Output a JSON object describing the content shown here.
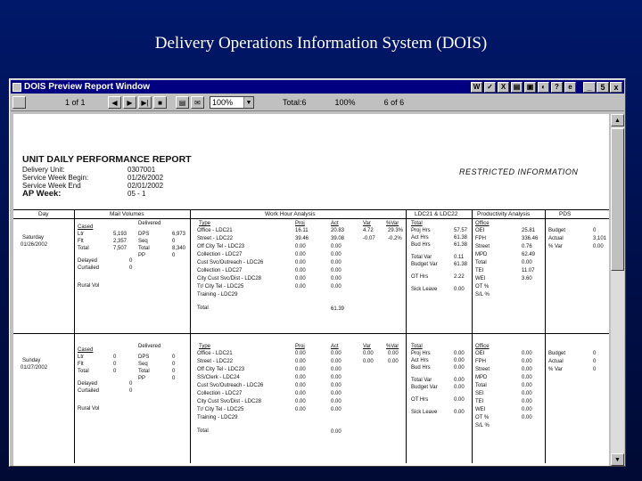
{
  "slide": {
    "title": "Delivery Operations Information System (DOIS)"
  },
  "window": {
    "title": "DOIS Preview Report Window",
    "title_icons": [
      "W",
      "✓",
      "X",
      "▤",
      "▣",
      "◐",
      "?",
      "e"
    ],
    "controls": {
      "minimize": "_",
      "restore": "5",
      "close": "x"
    }
  },
  "toolbar": {
    "page": "1 of 1",
    "zoom": "100%",
    "total": "Total:6",
    "percent": "100%",
    "of": "6 of 6",
    "buttons": [
      "◀",
      "▶",
      "▶|",
      "■"
    ]
  },
  "report": {
    "title": "UNIT DAILY PERFORMANCE REPORT",
    "restricted": "RESTRICTED INFORMATION",
    "info_labels": [
      "Delivery Unit:",
      "Service Week Begin:",
      "Service Week End",
      "AP Week:"
    ],
    "info_values": [
      "0307001",
      "01/26/2002",
      "02/01/2002",
      "05 - 1"
    ],
    "section_headers": {
      "day": "Day",
      "mail_volumes": "Mail Volumes",
      "work_hour_analysis": "Work Hour Analysis",
      "ldc": "LDC21 & LDC22",
      "productivity": "Productivity Analysis",
      "pds": "PDS"
    },
    "day1": {
      "day_name": "Saturday",
      "date": "01/26/2002",
      "cased": [
        "Cased",
        "Ltr",
        "Flt",
        "Total"
      ],
      "cased_vals": [
        "5,193",
        "2,357",
        "7,507"
      ],
      "delivered_head": "Delivered",
      "delivered": [
        "DPS",
        "Seq",
        "Total",
        "PP"
      ],
      "delivered_vals": [
        "6,973",
        "0",
        "8,340",
        "0"
      ],
      "other_vols": [
        "Delayed",
        "Curtailed",
        "Rural Vol"
      ],
      "other_vals": [
        "0",
        "0"
      ],
      "type_head": "Type",
      "types": [
        "Office - LDC21",
        "Street - LDC22",
        "Off City Tel - LDC23",
        "Collection - LDC27",
        "Cust Svc/Outreach - LDC26",
        "Collection - LDC27",
        "City Cust Svc/Dist - LDC28",
        "Tr/ City Tel - LDC25",
        "Training - LDC29",
        "Total"
      ],
      "col_heads": [
        "Proj",
        "Act",
        "Var",
        "%Var"
      ],
      "proj": [
        "16.11",
        "39.46",
        "0.00",
        "0.00",
        "0.00",
        "0.00",
        "0.00",
        "0.00"
      ],
      "act": [
        "20.83",
        "39.08",
        "0.00",
        "0.00",
        "0.00",
        "0.00",
        "0.00",
        "0.00"
      ],
      "var": [
        "4.72",
        "-0.07"
      ],
      "pvar": [
        "29.3%",
        "-0.2%"
      ],
      "total_val": "61.39",
      "mid_labels": [
        "Total",
        "Proj Hrs",
        "Act Hrs",
        "Bud Hrs",
        "Total Var",
        "Budget Var",
        "OT Hrs",
        "Sick Leave"
      ],
      "mid_vals": [
        "57.57",
        "61.38",
        "61.38",
        "0.11",
        "61.38",
        "2.22",
        "0.00"
      ],
      "office_head": "Office",
      "office": [
        "OEI",
        "FPH",
        "Street",
        "MPD",
        "Total",
        "TEI",
        "WEI",
        "OT %",
        "S/L %"
      ],
      "office_vals": [
        "25.81",
        "336.46",
        "0.76",
        "62.49",
        "0.00",
        "11.07",
        "3.60"
      ],
      "pds": [
        "Budget",
        "Actual",
        "% Var"
      ],
      "pds_vals": [
        "0",
        "3,101",
        "0.00"
      ]
    },
    "day2": {
      "day_name": "Sunday",
      "date": "01/27/2002",
      "cased": [
        "Cased",
        "Ltr",
        "Flt",
        "Total"
      ],
      "cased_vals": [
        "0",
        "0",
        "0"
      ],
      "delivered_head": "Delivered",
      "delivered": [
        "DPS",
        "Seq",
        "Total",
        "PP"
      ],
      "delivered_vals": [
        "0",
        "0",
        "0",
        "0"
      ],
      "other_vols": [
        "Delayed",
        "Curtailed",
        "Rural Vol"
      ],
      "other_vals": [
        "0",
        "0"
      ],
      "type_head": "Type",
      "types": [
        "Office - LDC21",
        "Street - LDC22",
        "Off City Tel - LDC23",
        "SS/Clerk - LDC24",
        "Cust Svc/Outreach - LDC26",
        "Collection - LDC27",
        "City Cust Svc/Dist - LDC28",
        "Tr/ City Tel - LDC25",
        "Training - LDC29",
        "Total"
      ],
      "col_heads": [
        "Proj",
        "Act",
        "Var",
        "%Var"
      ],
      "proj": [
        "0.00",
        "0.00",
        "0.00",
        "0.00",
        "0.00",
        "0.00",
        "0.00",
        "0.00"
      ],
      "act": [
        "0.00",
        "0.00",
        "0.00",
        "0.00",
        "0.00",
        "0.00",
        "0.00",
        "0.00"
      ],
      "var": [
        "0.00",
        "0.00"
      ],
      "pvar": [
        "0.00",
        "0.00"
      ],
      "total_val": "0.00",
      "mid_labels": [
        "Total",
        "Proj Hrs",
        "Act Hrs",
        "Bud Hrs",
        "Total Var",
        "Budget Var",
        "OT Hrs",
        "Sick Leave"
      ],
      "mid_vals": [
        "0.00",
        "0.00",
        "0.00",
        "0.00",
        "0.00",
        "0.00",
        "0.00"
      ],
      "office_head": "Office",
      "office": [
        "OEI",
        "FPH",
        "Street",
        "MPD",
        "Total",
        "SEI",
        "TEI",
        "WEI",
        "OT %",
        "S/L %"
      ],
      "office_vals": [
        "0.00",
        "0.00",
        "0.00",
        "0.00",
        "0.00",
        "0.00",
        "0.00",
        "0.00",
        "0.00"
      ],
      "pds": [
        "Budget",
        "Actual",
        "% Var"
      ],
      "pds_vals": [
        "0",
        "0",
        "0"
      ]
    }
  }
}
